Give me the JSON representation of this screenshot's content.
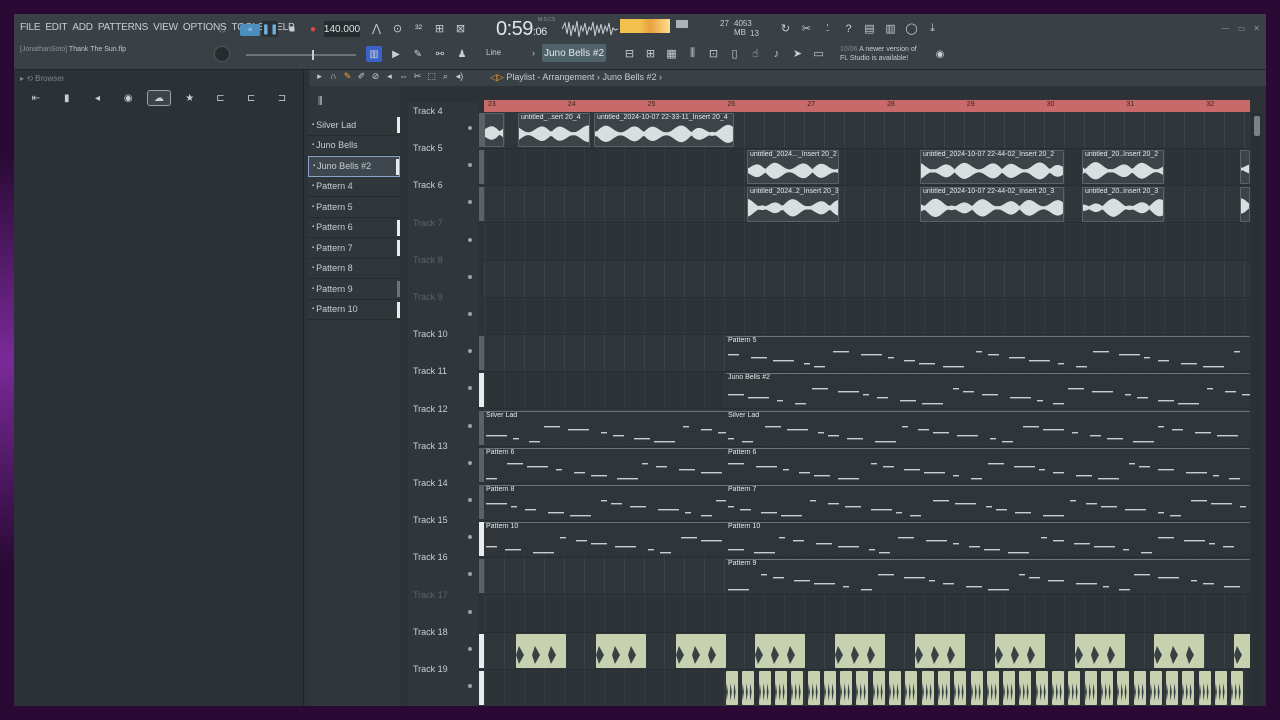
{
  "menu": [
    "FILE",
    "EDIT",
    "ADD",
    "PATTERNS",
    "VIEW",
    "OPTIONS",
    "TOOLS",
    "HELP"
  ],
  "project": {
    "user": "[JonathanSoto]",
    "file": "Thank The Sun.flp"
  },
  "transport": {
    "tempo": "140.000",
    "time_main": "0:59",
    "time_sub": "06",
    "time_unit": "M:S:CS"
  },
  "cpu": {
    "value": "27",
    "memory": "4053 MB",
    "voices": "13"
  },
  "pattern_selector": "Juno Bells #2",
  "snap": "Line",
  "news": {
    "date": "10/06",
    "line1": "A newer version of",
    "line2": "FL Studio is available!"
  },
  "browser": {
    "title": "Browser"
  },
  "playlist": {
    "title": "Playlist - Arrangement",
    "sep": "›",
    "pattern": "Juno Bells #2",
    "sep2": "›"
  },
  "patterns": [
    {
      "name": "Silver Lad",
      "bar": "on"
    },
    {
      "name": "Juno Bells",
      "bar": "none"
    },
    {
      "name": "Juno Bells #2",
      "bar": "on",
      "selected": true
    },
    {
      "name": "Pattern 4",
      "bar": "none"
    },
    {
      "name": "Pattern 5",
      "bar": "none"
    },
    {
      "name": "Pattern 6",
      "bar": "on"
    },
    {
      "name": "Pattern 7",
      "bar": "on"
    },
    {
      "name": "Pattern 8",
      "bar": "none"
    },
    {
      "name": "Pattern 9",
      "bar": "dim"
    },
    {
      "name": "Pattern 10",
      "bar": "on"
    }
  ],
  "ruler": [
    "23",
    "24",
    "25",
    "26",
    "27",
    "28",
    "29",
    "30",
    "31",
    "32"
  ],
  "tracks": [
    {
      "name": "Track 4",
      "active": true,
      "mute": "dim"
    },
    {
      "name": "Track 5",
      "active": true,
      "mute": "dim"
    },
    {
      "name": "Track 6",
      "active": true,
      "mute": "dim"
    },
    {
      "name": "Track 7",
      "active": false,
      "mute": "none"
    },
    {
      "name": "Track 8",
      "active": false,
      "mute": "none"
    },
    {
      "name": "Track 9",
      "active": false,
      "mute": "none"
    },
    {
      "name": "Track 10",
      "active": true,
      "mute": "dim"
    },
    {
      "name": "Track 11",
      "active": true,
      "mute": "on"
    },
    {
      "name": "Track 12",
      "active": true,
      "mute": "dim"
    },
    {
      "name": "Track 13",
      "active": true,
      "mute": "dim"
    },
    {
      "name": "Track 14",
      "active": true,
      "mute": "dim"
    },
    {
      "name": "Track 15",
      "active": true,
      "mute": "on"
    },
    {
      "name": "Track 16",
      "active": true,
      "mute": "dim"
    },
    {
      "name": "Track 17",
      "active": false,
      "mute": "none"
    },
    {
      "name": "Track 18",
      "active": true,
      "mute": "on"
    },
    {
      "name": "Track 19",
      "active": true,
      "mute": "on"
    }
  ],
  "clip_labels": {
    "t4a": "untitled_..sert 20_4",
    "t4b": "untitled_2024-10-07 22-33-11_Insert 20_4",
    "t5a": "untitled_2024..._Insert 20_2",
    "t5b": "untitled_2024-10-07 22-44-02_Insert 20_2",
    "t5c": "untitled_20..Insert 20_2",
    "t6a": "untitled_2024..2_Insert 20_3",
    "t6b": "untitled_2024-10-07 22-44-02_Insert 20_3",
    "t6c": "untitled_20..Insert 20_3",
    "p5": "Pattern 5",
    "jb2": "Juno Bells #2",
    "sl1": "Silver Lad",
    "sl2": "Silver Lad",
    "p6a": "Pattern 6",
    "p6b": "Pattern 6",
    "p8": "Pattern 8",
    "p7": "Pattern 7",
    "p10a": "Pattern 10",
    "p10b": "Pattern 10",
    "p9": "Pattern 9"
  },
  "colors": {
    "accent": "#f0a030",
    "ruler": "#c96a6a",
    "selection": "#8aa3c9",
    "record": "#e04848"
  }
}
